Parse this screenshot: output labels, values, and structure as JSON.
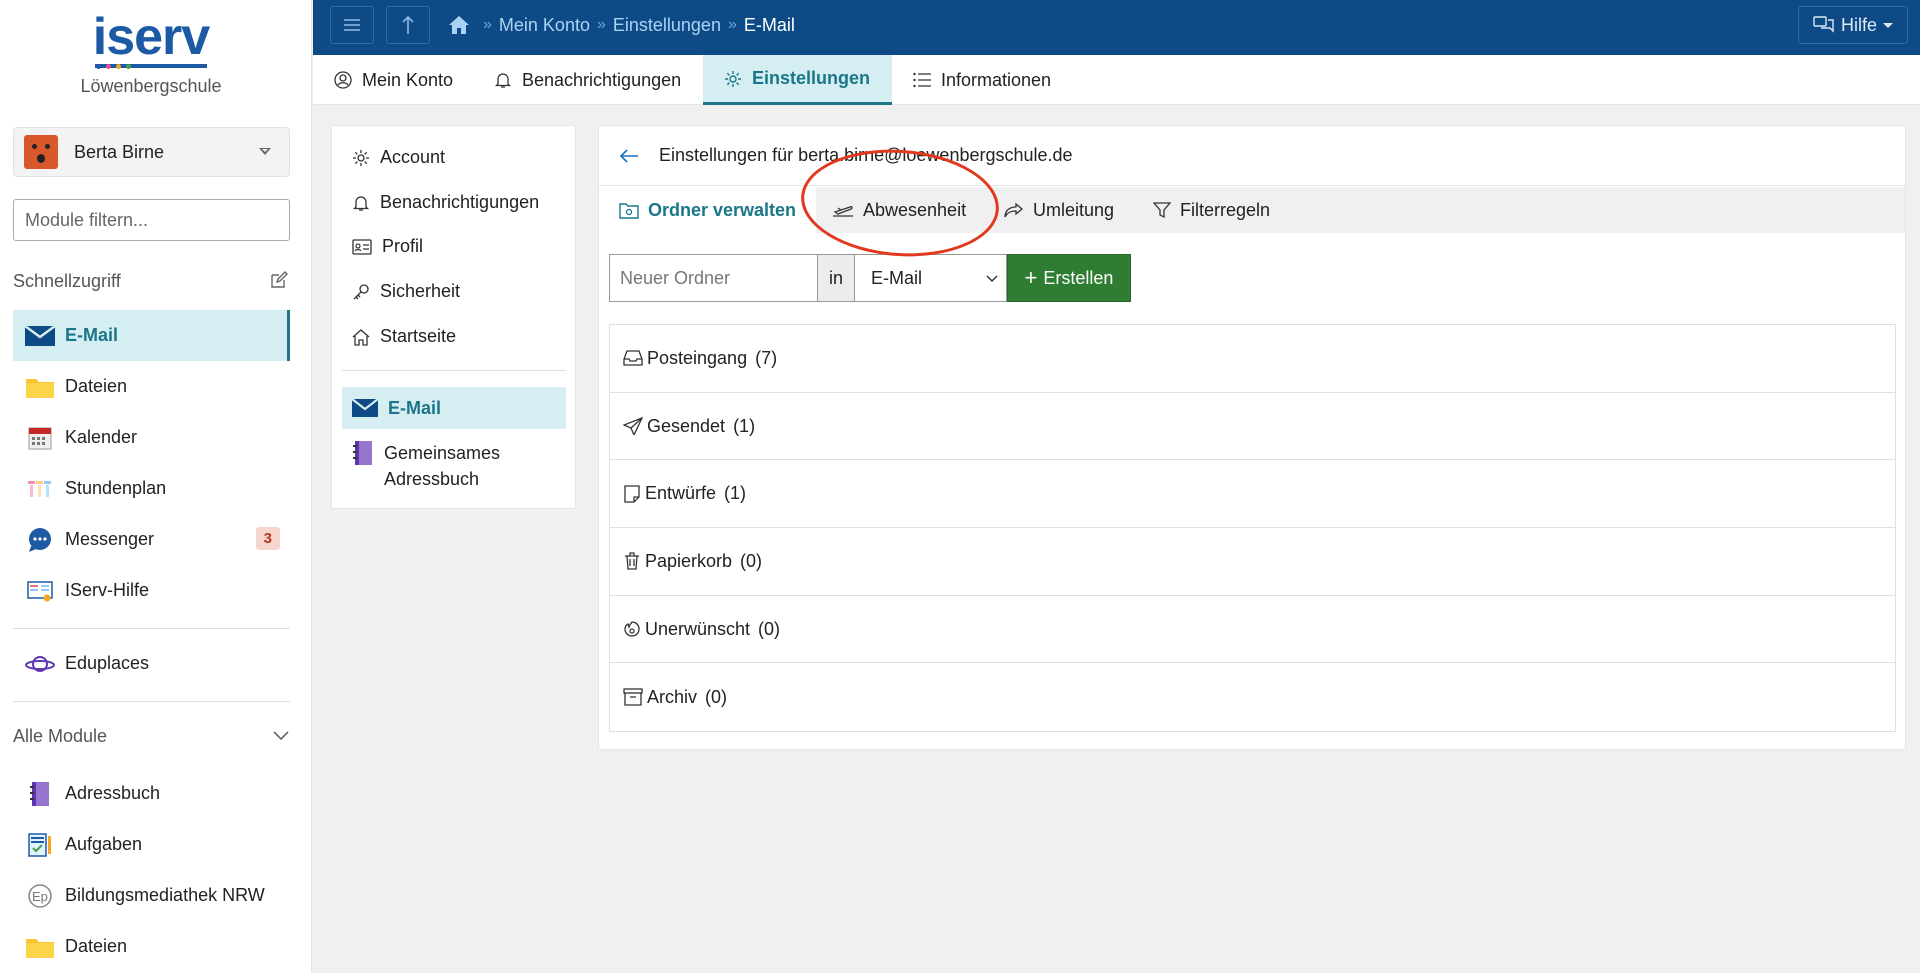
{
  "sidebar": {
    "logo_text": "iserv",
    "school": "Löwenbergschule",
    "user_name": "Berta Birne",
    "filter_placeholder": "Module filtern...",
    "quick_access_label": "Schnellzugriff",
    "quick_items": [
      {
        "label": "E-Mail",
        "icon": "mail-icon",
        "active": true
      },
      {
        "label": "Dateien",
        "icon": "folder-icon"
      },
      {
        "label": "Kalender",
        "icon": "calendar-icon"
      },
      {
        "label": "Stundenplan",
        "icon": "timetable-icon"
      },
      {
        "label": "Messenger",
        "icon": "messenger-icon",
        "badge": "3"
      },
      {
        "label": "IServ-Hilfe",
        "icon": "help-book-icon"
      }
    ],
    "eduplaces_label": "Eduplaces",
    "all_modules_label": "Alle Module",
    "all_items": [
      {
        "label": "Adressbuch",
        "icon": "addressbook-icon"
      },
      {
        "label": "Aufgaben",
        "icon": "tasks-icon"
      },
      {
        "label": "Bildungsmediathek NRW",
        "icon": "mediathek-icon"
      },
      {
        "label": "Dateien",
        "icon": "folder-icon"
      }
    ]
  },
  "topbar": {
    "breadcrumbs": [
      "Mein Konto",
      "Einstellungen",
      "E-Mail"
    ],
    "help_label": "Hilfe"
  },
  "tabs": [
    {
      "label": "Mein Konto",
      "icon": "user-circle-icon"
    },
    {
      "label": "Benachrichtigungen",
      "icon": "bell-icon"
    },
    {
      "label": "Einstellungen",
      "icon": "gear-icon",
      "active": true
    },
    {
      "label": "Informationen",
      "icon": "list-icon"
    }
  ],
  "settings_nav": {
    "items": [
      "Account",
      "Benachrichtigungen",
      "Profil",
      "Sicherheit",
      "Startseite"
    ],
    "active": "E-Mail",
    "address_line1": "Gemeinsames",
    "address_line2": "Adressbuch"
  },
  "main": {
    "title": "Einstellungen für berta.birne@loewenbergschule.de",
    "subtabs": [
      "Ordner verwalten",
      "Abwesenheit",
      "Umleitung",
      "Filterregeln"
    ],
    "new_folder_placeholder": "Neuer Ordner",
    "in_label": "in",
    "target_folder": "E-Mail",
    "create_label": "Erstellen",
    "folders": [
      {
        "name": "Posteingang",
        "count": "(7)",
        "icon": "inbox-icon"
      },
      {
        "name": "Gesendet",
        "count": "(1)",
        "icon": "send-icon"
      },
      {
        "name": "Entwürfe",
        "count": "(1)",
        "icon": "draft-icon"
      },
      {
        "name": "Papierkorb",
        "count": "(0)",
        "icon": "trash-icon"
      },
      {
        "name": "Unerwünscht",
        "count": "(0)",
        "icon": "spam-icon"
      },
      {
        "name": "Archiv",
        "count": "(0)",
        "icon": "archive-icon"
      }
    ]
  },
  "colors": {
    "topbar": "#0e4a85",
    "accent": "#1a7688",
    "active_bg": "#d5eef2",
    "create_button": "#2e7d32",
    "annotation": "#e0391e"
  }
}
